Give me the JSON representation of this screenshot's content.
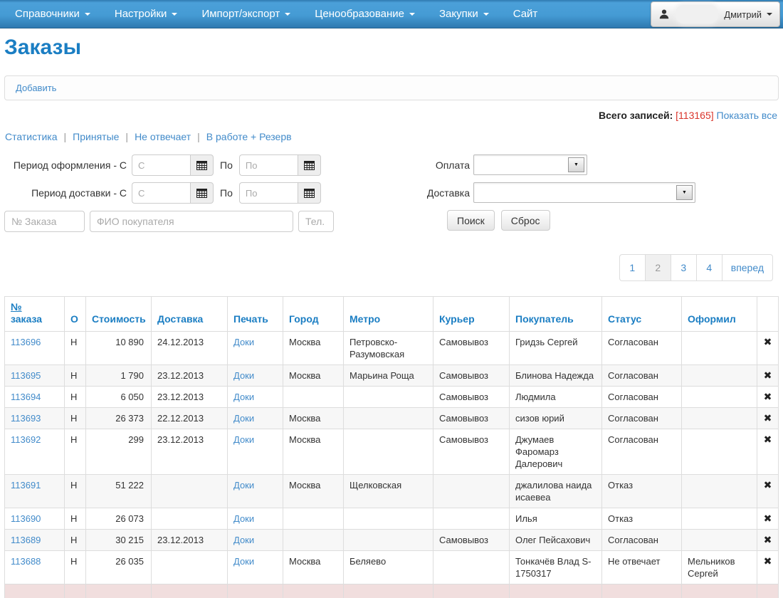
{
  "navbar": {
    "items": [
      {
        "label": "Справочники",
        "caret": true
      },
      {
        "label": "Настройки",
        "caret": true
      },
      {
        "label": "Импорт/экспорт",
        "caret": true
      },
      {
        "label": "Ценообразование",
        "caret": true
      },
      {
        "label": "Закупки",
        "caret": true
      },
      {
        "label": "Сайт",
        "caret": false
      }
    ],
    "user": {
      "name": "Дмитрий"
    }
  },
  "page_title": "Заказы",
  "toolbar": {
    "add_label": "Добавить"
  },
  "records": {
    "label": "Всего записей:",
    "count": "[113165]",
    "show_all": "Показать все"
  },
  "filter_links": [
    "Статистика",
    "Принятые",
    "Не отвечает",
    "В работе + Резерв"
  ],
  "filters": {
    "period_registration_label": "Период оформления - С",
    "period_delivery_label": "Период доставки - С",
    "to_label": "По",
    "from_placeholder": "С",
    "to_placeholder": "По",
    "order_placeholder": "№ Заказа",
    "fio_placeholder": "ФИО покупателя",
    "tel_placeholder": "Тел.",
    "payment_label": "Оплата",
    "delivery_label": "Доставка",
    "payment_value": "",
    "delivery_value": "",
    "search_button": "Поиск",
    "reset_button": "Сброс"
  },
  "pagination": {
    "pages": [
      "1",
      "2",
      "3",
      "4"
    ],
    "active": "2",
    "next_label": "вперед"
  },
  "table": {
    "headers": [
      "№ заказа",
      "О",
      "Стоимость",
      "Доставка",
      "Печать",
      "Город",
      "Метро",
      "Курьер",
      "Покупатель",
      "Статус",
      "Оформил",
      ""
    ],
    "docs_label": "Доки",
    "remove_glyph": "✖",
    "rows": [
      {
        "id": "113696",
        "o": "Н",
        "cost": "10 890",
        "delivery": "24.12.2013",
        "city": "Москва",
        "metro": "Петровско-Разумовская",
        "courier": "Самовывоз",
        "buyer": "Гридзь Сергей",
        "status": "Согласован",
        "manager": ""
      },
      {
        "id": "113695",
        "o": "Н",
        "cost": "1 790",
        "delivery": "23.12.2013",
        "city": "Москва",
        "metro": "Марьина Роща",
        "courier": "Самовывоз",
        "buyer": "Блинова Надежда",
        "status": "Согласован",
        "manager": ""
      },
      {
        "id": "113694",
        "o": "Н",
        "cost": "6 050",
        "delivery": "23.12.2013",
        "city": "",
        "metro": "",
        "courier": "Самовывоз",
        "buyer": "Людмила",
        "status": "Согласован",
        "manager": ""
      },
      {
        "id": "113693",
        "o": "Н",
        "cost": "26 373",
        "delivery": "22.12.2013",
        "city": "Москва",
        "metro": "",
        "courier": "Самовывоз",
        "buyer": "сизов юрий",
        "status": "Согласован",
        "manager": ""
      },
      {
        "id": "113692",
        "o": "Н",
        "cost": "299",
        "delivery": "23.12.2013",
        "city": "Москва",
        "metro": "",
        "courier": "Самовывоз",
        "buyer": "Джумаев Фаромарз Далерович",
        "status": "Согласован",
        "manager": ""
      },
      {
        "id": "113691",
        "o": "Н",
        "cost": "51 222",
        "delivery": "",
        "city": "Москва",
        "metro": "Щелковская",
        "courier": "",
        "buyer": "джалилова наида исаевеа",
        "status": "Отказ",
        "manager": ""
      },
      {
        "id": "113690",
        "o": "Н",
        "cost": "26 073",
        "delivery": "",
        "city": "",
        "metro": "",
        "courier": "",
        "buyer": "Илья",
        "status": "Отказ",
        "manager": ""
      },
      {
        "id": "113689",
        "o": "Н",
        "cost": "30 215",
        "delivery": "23.12.2013",
        "city": "",
        "metro": "",
        "courier": "Самовывоз",
        "buyer": "Олег Пейсахович",
        "status": "Согласован",
        "manager": ""
      },
      {
        "id": "113688",
        "o": "Н",
        "cost": "26 035",
        "delivery": "",
        "city": "Москва",
        "metro": "Беляево",
        "courier": "",
        "buyer": "Тонкачёв Влад S-1750317",
        "status": "Не отвечает",
        "manager": "Мельников Сергей"
      }
    ],
    "partial_row_visible": true
  },
  "colors": {
    "accent_blue": "#1b7ec3",
    "link_blue": "#428bca",
    "count_red": "#d9342b",
    "partial_row_pink": "#f1dede",
    "navbar_blue": "#459bd4"
  },
  "icons": {
    "user": "person-icon",
    "calendar": "calendar-icon",
    "caret": "caret-down-icon",
    "select_arrow": "▼",
    "remove": "remove-icon"
  }
}
